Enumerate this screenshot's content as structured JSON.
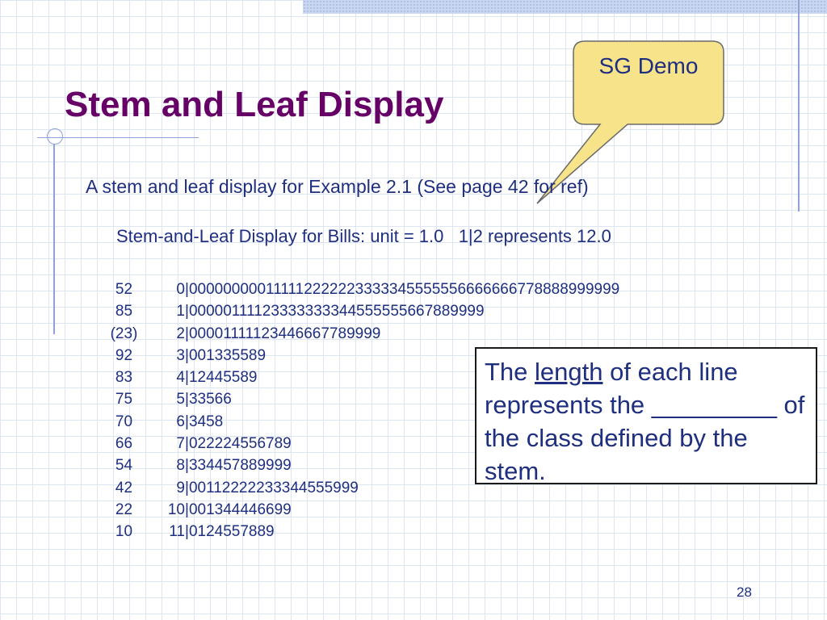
{
  "slide": {
    "title": "Stem and Leaf Display",
    "callout": "SG Demo",
    "subtitle": "A stem and leaf display for Example 2.1 (See page 42 for ref)",
    "caption": "Stem-and-Leaf Display for Bills: unit = 1.0   1|2 represents 12.0",
    "page_number": "28"
  },
  "display": {
    "rows": [
      {
        "depth": "52",
        "stem": "0",
        "leaves": "000000000111112222223333345555556666666778888999999"
      },
      {
        "depth": "85",
        "stem": "1",
        "leaves": "00000111123333333344555555667889999"
      },
      {
        "depth": "(23)",
        "stem": "2",
        "leaves": "00001111123446667789999"
      },
      {
        "depth": "92",
        "stem": "3",
        "leaves": "001335589"
      },
      {
        "depth": "83",
        "stem": "4",
        "leaves": "12445589"
      },
      {
        "depth": "75",
        "stem": "5",
        "leaves": "33566"
      },
      {
        "depth": "70",
        "stem": "6",
        "leaves": "3458"
      },
      {
        "depth": "66",
        "stem": "7",
        "leaves": "022224556789"
      },
      {
        "depth": "54",
        "stem": "8",
        "leaves": "334457889999"
      },
      {
        "depth": "42",
        "stem": "9",
        "leaves": "00112222233344555999"
      },
      {
        "depth": "22",
        "stem": "10",
        "leaves": "001344446699"
      },
      {
        "depth": "10",
        "stem": "11",
        "leaves": "0124557889"
      }
    ],
    "separator": "|"
  },
  "question_box": {
    "prefix": "The ",
    "underlined": "length",
    "rest": " of each line represents the _________ of the class defined by the stem."
  }
}
